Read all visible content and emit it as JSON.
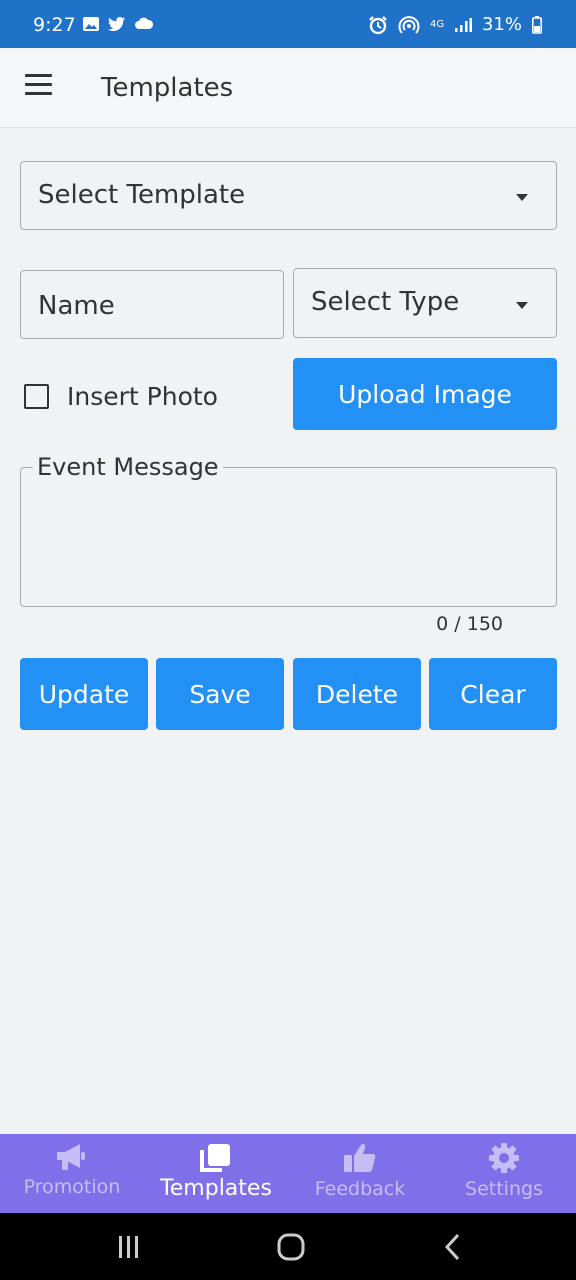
{
  "status_bar": {
    "time": "9:27",
    "battery": "31%",
    "network": "4G"
  },
  "app_bar": {
    "title": "Templates"
  },
  "form": {
    "template_select": "Select Template",
    "name_placeholder": "Name",
    "type_select": "Select Type",
    "insert_photo_label": "Insert Photo",
    "upload_button": "Upload Image",
    "message_label": "Event Message",
    "counter": "0 / 150"
  },
  "actions": {
    "update": "Update",
    "save": "Save",
    "delete": "Delete",
    "clear": "Clear"
  },
  "bottom_nav": [
    {
      "label": "Promotion",
      "icon": "megaphone-icon"
    },
    {
      "label": "Templates",
      "icon": "templates-icon",
      "active": true
    },
    {
      "label": "Feedback",
      "icon": "thumbs-up-icon"
    },
    {
      "label": "Settings",
      "icon": "gear-icon"
    }
  ],
  "colors": {
    "status_bar": "#1f72c7",
    "accent": "#2290f5",
    "bottom_nav": "#7f6fe8",
    "nav_inactive": "#c5bdf3"
  }
}
